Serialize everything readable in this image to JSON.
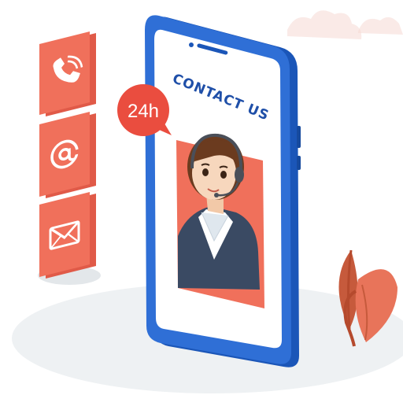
{
  "screen": {
    "heading": "CONTACT US"
  },
  "badge": {
    "label": "24h"
  },
  "side_icons": [
    {
      "icon": "phone-icon"
    },
    {
      "icon": "at-sign-icon"
    },
    {
      "icon": "envelope-icon"
    }
  ],
  "colors": {
    "accent_coral": "#f0705b",
    "phone_frame_blue": "#2f6fd6",
    "heading_blue": "#1f4fa8",
    "badge_red": "#ea4d3f"
  }
}
